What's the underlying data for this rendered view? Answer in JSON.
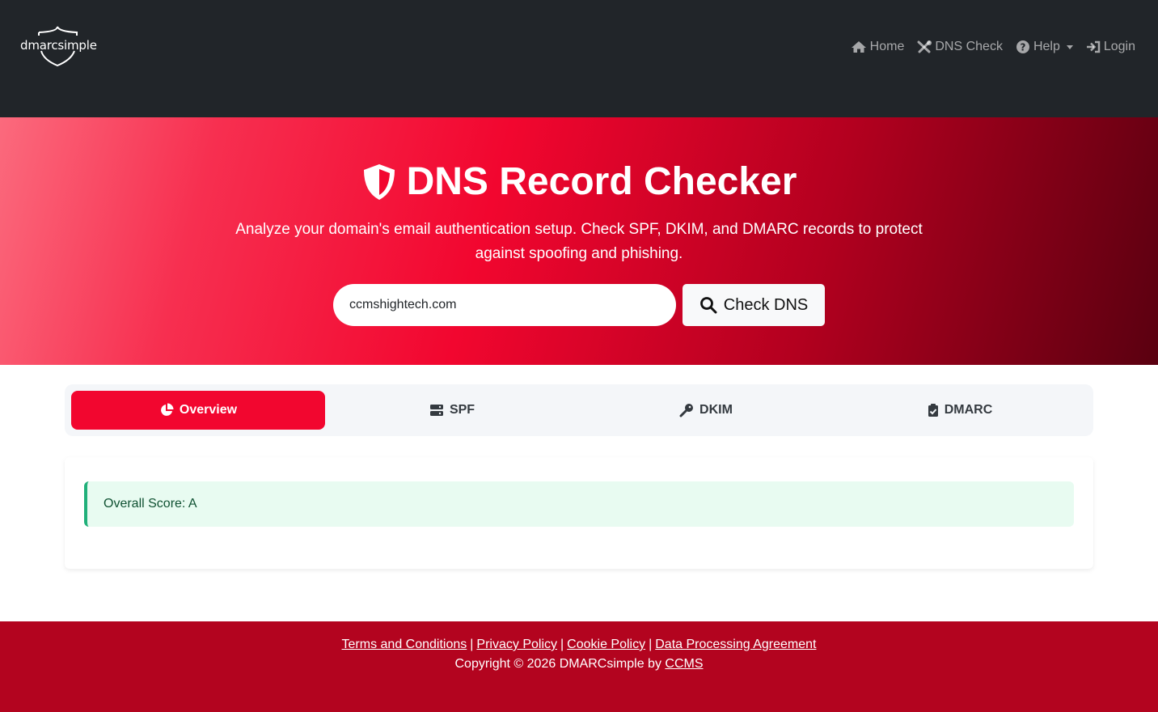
{
  "brand": {
    "logo_text": "dmarcsimple"
  },
  "nav": {
    "home": "Home",
    "dns_check": "DNS Check",
    "help": "Help",
    "login": "Login"
  },
  "hero": {
    "title": "DNS Record Checker",
    "subtitle": "Analyze your domain's email authentication setup. Check SPF, DKIM, and DMARC records to protect against spoofing and phishing.",
    "search_value": "ccmshightech.com",
    "check_button": "Check DNS"
  },
  "tabs": [
    {
      "label": "Overview",
      "active": true
    },
    {
      "label": "SPF",
      "active": false
    },
    {
      "label": "DKIM",
      "active": false
    },
    {
      "label": "DMARC",
      "active": false
    }
  ],
  "result": {
    "overall_score": "Overall Score: A"
  },
  "footer": {
    "links": [
      "Terms and Conditions",
      "Privacy Policy",
      "Cookie Policy",
      "Data Processing Agreement"
    ],
    "separator": "|",
    "copyright_prefix": "Copyright © 2026 DMARCsimple by",
    "copyright_link": "CCMS"
  },
  "colors": {
    "navbar": "#212529",
    "accent": "#f2062f",
    "footer": "#b3041f",
    "success_bg": "#e8fbf1",
    "success_border": "#20b07a"
  }
}
